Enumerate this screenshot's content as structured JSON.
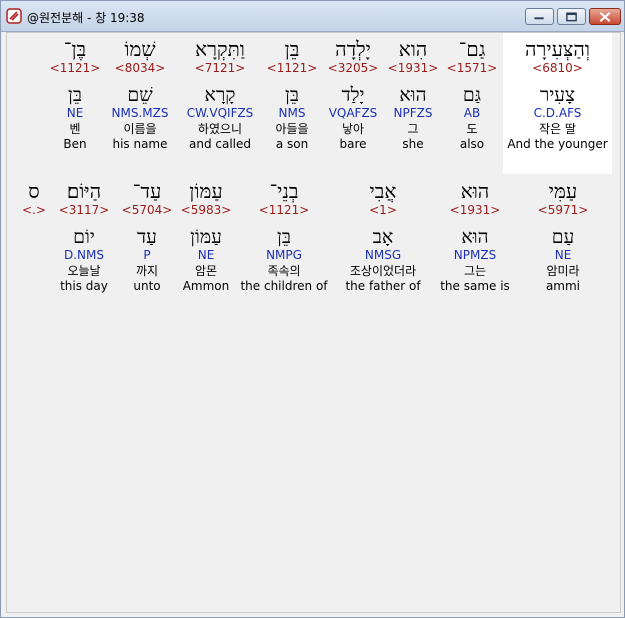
{
  "window": {
    "title": "@원전분해 - 창 19:38"
  },
  "lines": [
    {
      "words": [
        {
          "heb": "וְהַצְּעִירָה",
          "num": "<6810>",
          "root": "צָעִיר",
          "parse": "C.D.AFS",
          "kor": "작은 딸",
          "eng": "And the younger",
          "highlight": true
        },
        {
          "heb": "גַם־",
          "num": "<1571>",
          "root": "גַּם",
          "parse": "AB",
          "kor": "도",
          "eng": "also"
        },
        {
          "heb": "הִוא",
          "num": "<1931>",
          "root": "הוּא",
          "parse": "NPFZS",
          "kor": "그",
          "eng": "she"
        },
        {
          "heb": "יָלְדָה",
          "num": "<3205>",
          "root": "יָלַד",
          "parse": "VQAFZS",
          "kor": "낳아",
          "eng": "bare"
        },
        {
          "heb": "בֵּן",
          "num": "<1121>",
          "root": "בֵּן",
          "parse": "NMS",
          "kor": "아들을",
          "eng": "a son"
        },
        {
          "heb": "וַתִּקְרָא",
          "num": "<7121>",
          "root": "קָרָא",
          "parse": "CW.VQIFZS",
          "kor": "하였으니",
          "eng": "and called"
        },
        {
          "heb": "שְׁמוֹ",
          "num": "<8034>",
          "root": "שֵׁם",
          "parse": "NMS.MZS",
          "kor": "이름을",
          "eng": "his name"
        },
        {
          "heb": "בֶּן־",
          "num": "<1121>",
          "root": "בֵּן",
          "parse": "NE",
          "kor": "벤",
          "eng": "Ben"
        }
      ]
    },
    {
      "words": [
        {
          "heb": "עַמִּי",
          "num": "<5971>",
          "root": "עַם",
          "parse": "NE",
          "kor": "암미라",
          "eng": "ammi"
        },
        {
          "heb": "הוּא",
          "num": "<1931>",
          "root": "הוּא",
          "parse": "NPMZS",
          "kor": "그는",
          "eng": "the same is"
        },
        {
          "heb": "אֲבִי",
          "num": "<1>",
          "root": "אָב",
          "parse": "NMSG",
          "kor": "조상이었더라",
          "eng": "the father of"
        },
        {
          "heb": "בְנֵי־",
          "num": "<1121>",
          "root": "בֵּן",
          "parse": "NMPG",
          "kor": "족속의",
          "eng": "the children of"
        },
        {
          "heb": "עַמּוֹן",
          "num": "<5983>",
          "root": "עַמּוֹן",
          "parse": "NE",
          "kor": "암몬",
          "eng": "Ammon"
        },
        {
          "heb": "עַד־",
          "num": "<5704>",
          "root": "עַד",
          "parse": "P",
          "kor": "까지",
          "eng": "unto"
        },
        {
          "heb": "הַיּוֹם׃",
          "num": "<3117>",
          "root": "יוֹם",
          "parse": "D.NMS",
          "kor": "오늘날",
          "eng": "this day"
        },
        {
          "heb": "ס",
          "num": "<.>"
        }
      ]
    }
  ]
}
